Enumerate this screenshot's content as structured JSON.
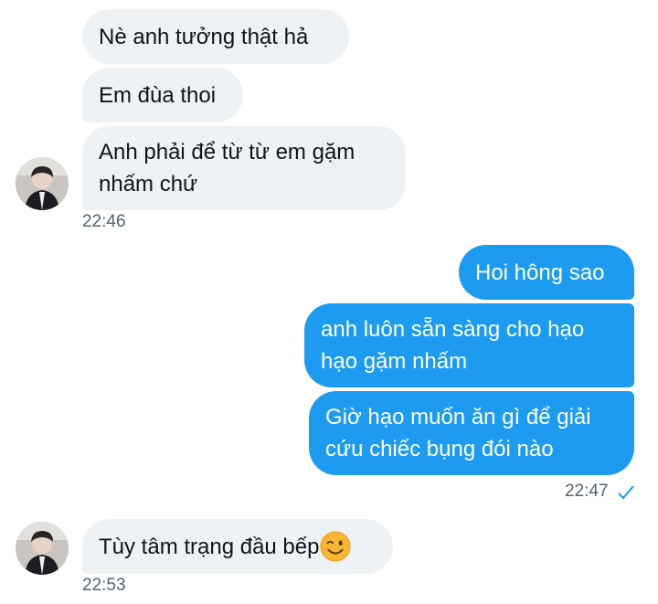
{
  "conversation": {
    "incoming_group_1": {
      "messages": [
        "Nè anh tưởng thật hả",
        "Em đùa thoi",
        "Anh phải để từ từ em gặm nhấm chứ"
      ],
      "timestamp": "22:46"
    },
    "outgoing_group": {
      "messages": [
        "Hoi hông sao",
        "anh luôn sẵn sàng cho hạo hạo gặm nhấm",
        "Giờ hạo muốn ăn gì để giải cứu chiếc bụng đói nào"
      ],
      "timestamp": "22:47",
      "status_icon": "check-icon"
    },
    "incoming_group_2": {
      "messages": [
        "Tùy tâm trạng đầu bếp"
      ],
      "emoji": "winking-face-emoji",
      "timestamp": "22:53"
    }
  },
  "colors": {
    "incoming_bubble": "#eff2f5",
    "outgoing_bubble": "#1d9bf0",
    "timestamp": "#536471",
    "check": "#1d9bf0"
  }
}
